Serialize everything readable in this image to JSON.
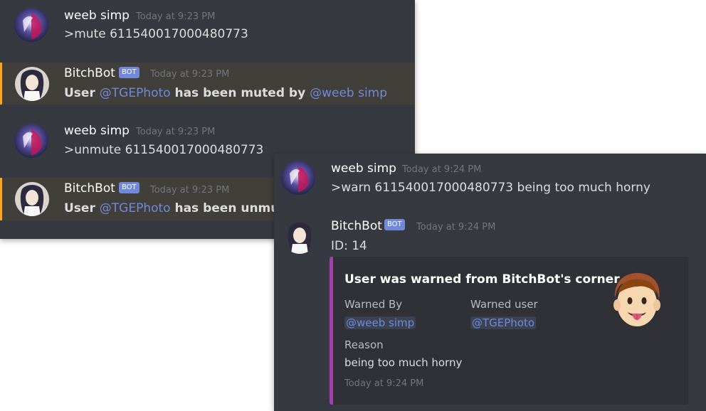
{
  "left_chat": {
    "messages": [
      {
        "author": "weeb simp",
        "timestamp": "Today at 9:23 PM",
        "content": ">mute 611540017000480773"
      },
      {
        "author": "BitchBot",
        "badge": "BOT",
        "timestamp": "Today at 9:23 PM",
        "content_prefix": "User",
        "mention_1": "@TGEPhoto",
        "content_middle": "has been muted by",
        "mention_2": "@weeb simp"
      },
      {
        "author": "weeb simp",
        "timestamp": "Today at 9:23 PM",
        "content": ">unmute 611540017000480773"
      },
      {
        "author": "BitchBot",
        "badge": "BOT",
        "timestamp": "Today at 9:23 PM",
        "content_prefix": "User",
        "mention_1": "@TGEPhoto",
        "content_middle": "has been unmute"
      }
    ]
  },
  "right_chat": {
    "messages": [
      {
        "author": "weeb simp",
        "timestamp": "Today at 9:24 PM",
        "content": ">warn 611540017000480773 being too much horny"
      },
      {
        "author": "BitchBot",
        "badge": "BOT",
        "timestamp": "Today at 9:24 PM",
        "content": "ID: 14"
      }
    ],
    "embed": {
      "title": "User was warned from BitchBot's corner",
      "fields": [
        {
          "name": "Warned By",
          "value": "@weeb simp"
        },
        {
          "name": "Warned user",
          "value": "@TGEPhoto"
        },
        {
          "name": "Reason",
          "value": "being too much horny"
        }
      ],
      "footer": "Today at 9:24 PM",
      "thumbnail_icon": "tongue-face-emoji-icon"
    }
  },
  "colors": {
    "background": "#36393f",
    "mention_highlight": "#413f39",
    "mention_border": "#faa61a",
    "bot_badge": "#7289da",
    "mention_text": "#7289da",
    "embed_background": "#2f3136",
    "embed_accent": "#a13fb3"
  }
}
